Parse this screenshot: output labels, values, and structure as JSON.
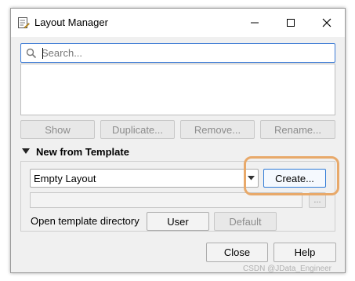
{
  "window": {
    "title": "Layout Manager"
  },
  "titlebar": {
    "minimize_icon": "minimize-icon",
    "maximize_icon": "maximize-icon",
    "close_icon": "close-icon"
  },
  "search": {
    "placeholder": "Search...",
    "value": ""
  },
  "layout_list": {
    "items": []
  },
  "list_actions": {
    "show": "Show",
    "duplicate": "Duplicate...",
    "remove": "Remove...",
    "rename": "Rename..."
  },
  "new_from_template": {
    "title": "New from Template",
    "template_selected": "Empty Layout",
    "create": "Create...",
    "browse": "...",
    "path_value": "",
    "open_template_directory": "Open template directory",
    "user": "User",
    "default": "Default"
  },
  "footer": {
    "close": "Close",
    "help": "Help"
  },
  "watermark": "CSDN @JData_Engineer",
  "colors": {
    "accent": "#3d7bd5",
    "highlight": "#e8a96a"
  }
}
